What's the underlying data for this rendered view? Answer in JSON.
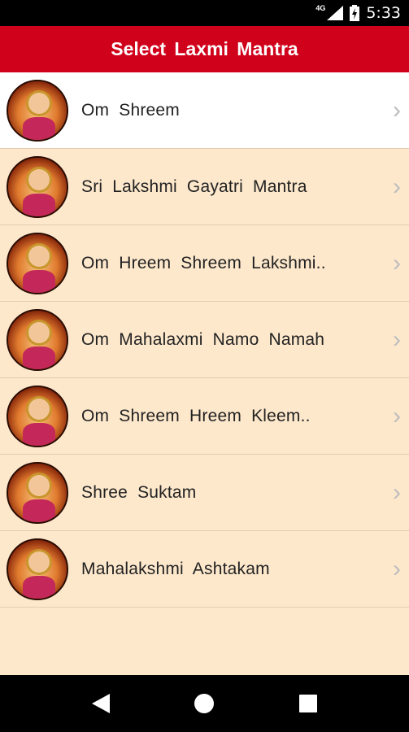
{
  "status_bar": {
    "network": "4G",
    "time": "5:33"
  },
  "app_bar": {
    "title": "Select Laxmi Mantra"
  },
  "list": {
    "items": [
      {
        "label": "Om Shreem"
      },
      {
        "label": "Sri Lakshmi Gayatri Mantra"
      },
      {
        "label": "Om Hreem Shreem Lakshmi.."
      },
      {
        "label": "Om Mahalaxmi Namo Namah"
      },
      {
        "label": "Om Shreem Hreem Kleem.."
      },
      {
        "label": "Shree Suktam"
      },
      {
        "label": "Mahalakshmi Ashtakam"
      }
    ],
    "chevron_icon": "chevron-right-icon"
  },
  "nav_bar": {
    "icons": [
      "back-icon",
      "home-icon",
      "recents-icon"
    ]
  },
  "colors": {
    "app_bar": "#d0021b",
    "list_background": "#fde8cc",
    "selected_row": "#ffffff"
  }
}
